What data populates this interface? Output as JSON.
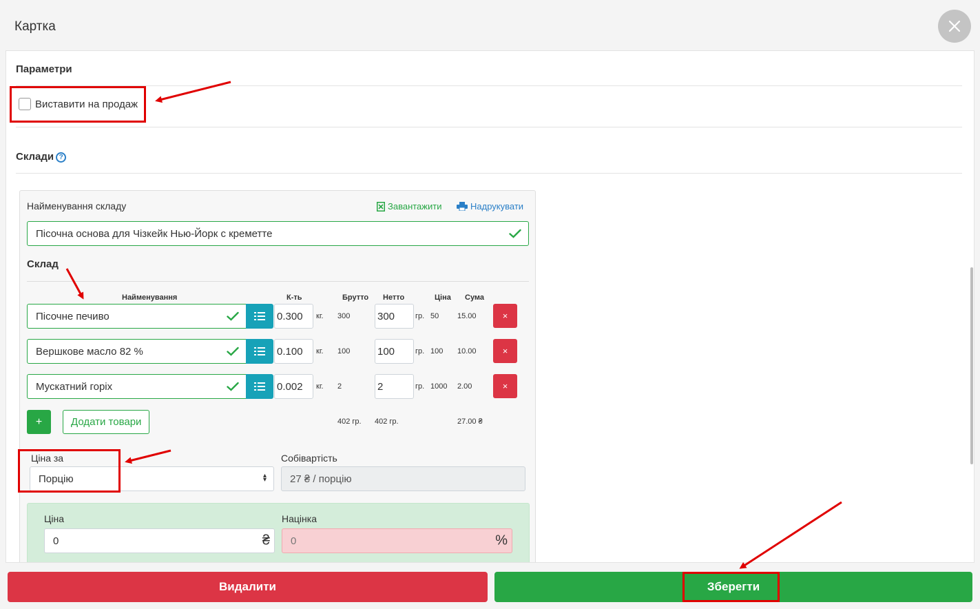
{
  "modal": {
    "title": "Картка"
  },
  "params": {
    "title": "Параметри",
    "for_sale_label": "Виставити на продаж"
  },
  "warehouses": {
    "title": "Склади",
    "help_icon": "question-circle-icon"
  },
  "card": {
    "name_label": "Найменування складу",
    "download_label": "Завантажити",
    "print_label": "Надрукувати",
    "name_value": "Пісочна основа для Чізкейк Нью-Йорк с креметте",
    "composition_title": "Склад",
    "columns": {
      "name": "Найменування",
      "qty": "К-ть",
      "gross": "Брутто",
      "net": "Нетто",
      "price": "Ціна",
      "sum": "Сума"
    },
    "rows": [
      {
        "name": "Пісочне печиво",
        "qty": "0.300",
        "qty_unit": "кг.",
        "gross": "300",
        "net": "300",
        "net_unit": "гр.",
        "price": "50",
        "sum": "15.00",
        "delete": "×"
      },
      {
        "name": "Вершкове масло 82 %",
        "qty": "0.100",
        "qty_unit": "кг.",
        "gross": "100",
        "net": "100",
        "net_unit": "гр.",
        "price": "100",
        "sum": "10.00",
        "delete": "×"
      },
      {
        "name": "Мускатний горіх",
        "qty": "0.002",
        "qty_unit": "кг.",
        "gross": "2",
        "net": "2",
        "net_unit": "гр.",
        "price": "1000",
        "sum": "2.00",
        "delete": "×"
      }
    ],
    "add_plus": "+",
    "add_goods": "Додати товари",
    "totals": {
      "gross": "402 гр.",
      "net": "402 гр.",
      "sum": "27.00 ₴"
    },
    "price_for_label": "Ціна за",
    "price_for_value": "Порцію",
    "cost_label": "Собівартість",
    "cost_value": "27 ₴ / порцію",
    "price_label": "Ціна",
    "price_value": "0",
    "price_suffix": "₴",
    "markup_label": "Націнка",
    "markup_value": "0",
    "markup_suffix": "%"
  },
  "footer": {
    "delete_label": "Видалити",
    "save_label": "Зберегти"
  },
  "colors": {
    "success": "#28a745",
    "danger": "#dc3545",
    "info": "#17a2b8",
    "annotation": "#e00000"
  }
}
